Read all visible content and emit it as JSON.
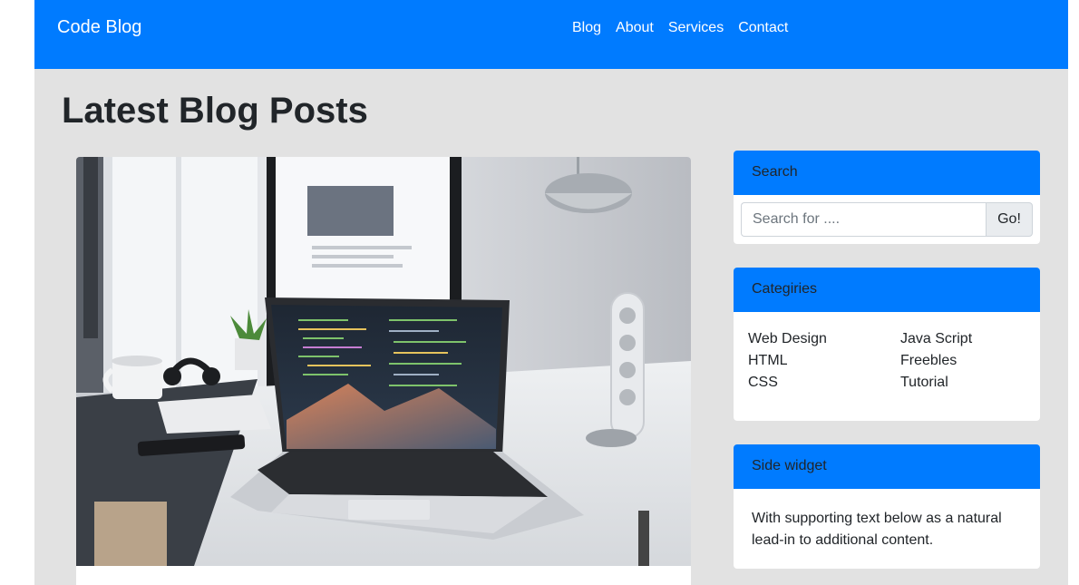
{
  "navbar": {
    "brand": "Code Blog",
    "links": [
      "Blog",
      "About",
      "Services",
      "Contact"
    ]
  },
  "main": {
    "heading": "Latest Blog Posts",
    "post_image": "laptop-on-desk-photo"
  },
  "sidebar": {
    "search": {
      "title": "Search",
      "placeholder": "Search for ....",
      "value": "",
      "button_label": "Go!"
    },
    "categories": {
      "title": "Categiries",
      "left": [
        "Web Design",
        "HTML",
        "CSS"
      ],
      "right": [
        "Java Script",
        "Freebles",
        "Tutorial"
      ]
    },
    "side_widget": {
      "title": "Side widget",
      "text": "With supporting text below as a natural lead-in to additional content."
    }
  },
  "colors": {
    "primary": "#007bff",
    "background": "#e2e2e2",
    "card": "#ffffff"
  }
}
